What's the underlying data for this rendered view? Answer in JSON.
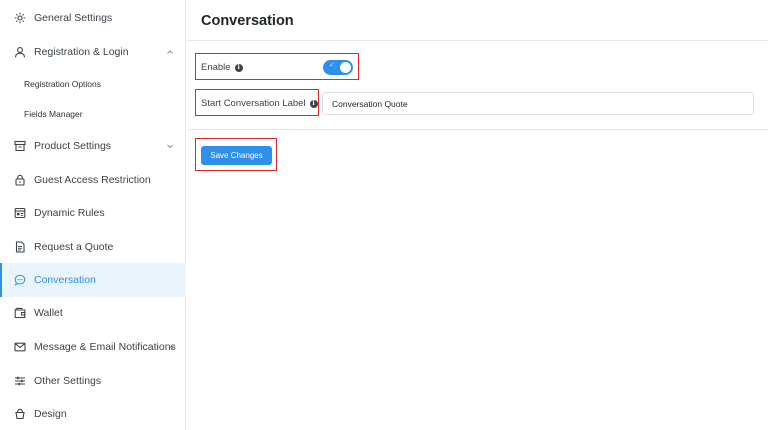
{
  "sidebar": {
    "items": [
      {
        "label": "General Settings",
        "icon": "gear-icon"
      },
      {
        "label": "Registration & Login",
        "icon": "user-icon",
        "expanded": true
      },
      {
        "label": "Registration Options"
      },
      {
        "label": "Fields Manager"
      },
      {
        "label": "Product Settings",
        "icon": "archive-box-icon",
        "expanded": false
      },
      {
        "label": "Guest Access Restriction",
        "icon": "lock-icon"
      },
      {
        "label": "Dynamic Rules",
        "icon": "rules-calendar-icon"
      },
      {
        "label": "Request a Quote",
        "icon": "document-icon"
      },
      {
        "label": "Conversation",
        "icon": "chat-bubble-icon",
        "active": true
      },
      {
        "label": "Wallet",
        "icon": "wallet-icon"
      },
      {
        "label": "Message & Email Notifications",
        "icon": "envelope-icon",
        "expanded": false
      },
      {
        "label": "Other Settings",
        "icon": "sliders-icon"
      },
      {
        "label": "Design",
        "icon": "design-icon"
      }
    ]
  },
  "main": {
    "title": "Conversation",
    "enable_label": "Enable",
    "enable_on": true,
    "start_label": "Start Conversation Label",
    "start_value": "Conversation Quote",
    "save_label": "Save Changes"
  },
  "colors": {
    "accent": "#2e90ea",
    "active_bg": "#eaf4fd",
    "highlight": "#e0292b"
  }
}
